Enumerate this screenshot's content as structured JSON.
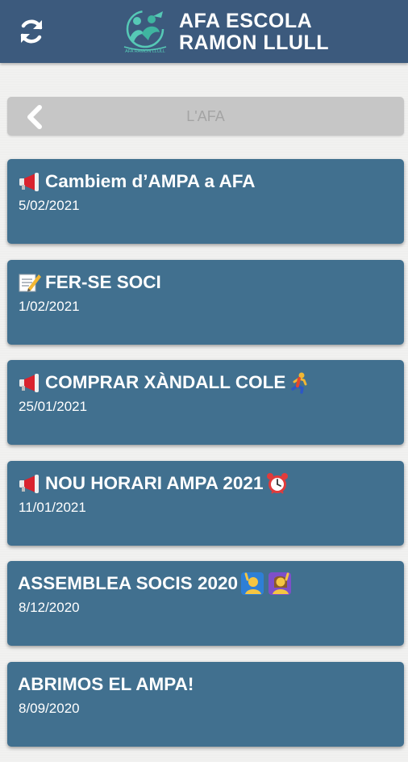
{
  "header": {
    "title_line1": "AFA ESCOLA",
    "title_line2": "RAMON LLULL",
    "refresh_icon": "refresh-icon",
    "logo_icon": "school-logo"
  },
  "nav": {
    "back_icon": "chevron-left-icon",
    "title": "L'AFA"
  },
  "news": [
    {
      "title": "Cambiem d’AMPA a AFA",
      "date": "5/02/2021",
      "lead_icon": "megaphone-icon",
      "trail_icon": ""
    },
    {
      "title": "FER-SE SOCI",
      "date": "1/02/2021",
      "lead_icon": "memo-icon",
      "trail_icon": ""
    },
    {
      "title": "COMPRAR XÀNDALL COLE",
      "date": "25/01/2021",
      "lead_icon": "megaphone-icon",
      "trail_icon": "runner-icon"
    },
    {
      "title": "NOU HORARI AMPA 2021",
      "date": "11/01/2021",
      "lead_icon": "megaphone-icon",
      "trail_icon": "alarm-clock-icon"
    },
    {
      "title": "ASSEMBLEA SOCIS 2020",
      "date": "8/12/2020",
      "lead_icon": "",
      "trail_icon": "raising-hand-icon"
    },
    {
      "title": "ABRIMOS EL AMPA!",
      "date": "8/09/2020",
      "lead_icon": "",
      "trail_icon": ""
    }
  ],
  "colors": {
    "app_bar": "#3c5a7d",
    "card": "#41708f",
    "back_bar": "#c6c6c6",
    "background": "#f1f1f0"
  }
}
